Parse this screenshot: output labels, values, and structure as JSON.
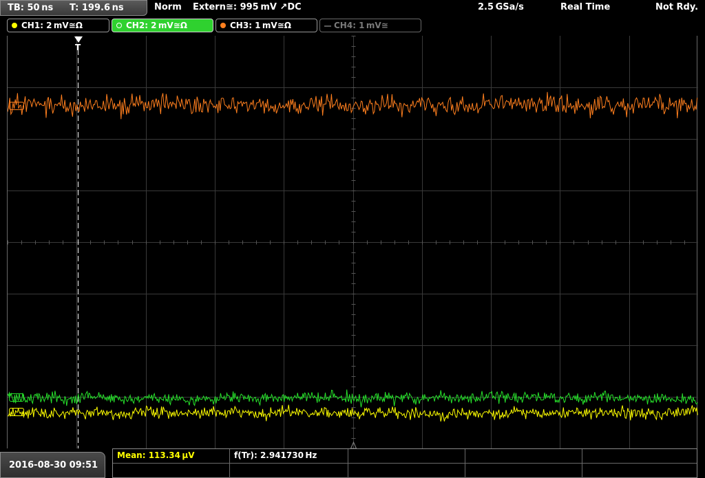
{
  "top_bar": {
    "timebase": "TB: 50 ns",
    "trigger_time": "T: 199.6 ns",
    "trigger_mode": "Norm",
    "trigger_source": "Extern≅: 995 mV ↗DC",
    "sample_rate": "2.5 GSa/s",
    "acq_mode": "Real Time",
    "status": "Not Rdy."
  },
  "channels": [
    {
      "label": "CH1: 2 mV≅Ω",
      "color": "#ffff00",
      "active": false,
      "enabled": true
    },
    {
      "label": "CH2: 2 mV≅Ω",
      "color": "#27e22b",
      "active": true,
      "enabled": true
    },
    {
      "label": "CH3: 1 mV≅Ω",
      "color": "#ff7f1e",
      "active": false,
      "enabled": true
    },
    {
      "label": "CH4: 1 mV≅",
      "color": "#7a7a7a",
      "active": false,
      "enabled": false
    }
  ],
  "trigger_marker": "T",
  "measurements": {
    "mean": "Mean: 113.34 µV",
    "freq": "f(Tr): 2.941730 Hz"
  },
  "datetime": "2016-08-30 09:51",
  "colors": {
    "ch1": "#ffff00",
    "ch2": "#27e22b",
    "ch3": "#ff7f1e",
    "grid": "#3a3a3a",
    "active_tab": "#2fd12f"
  }
}
